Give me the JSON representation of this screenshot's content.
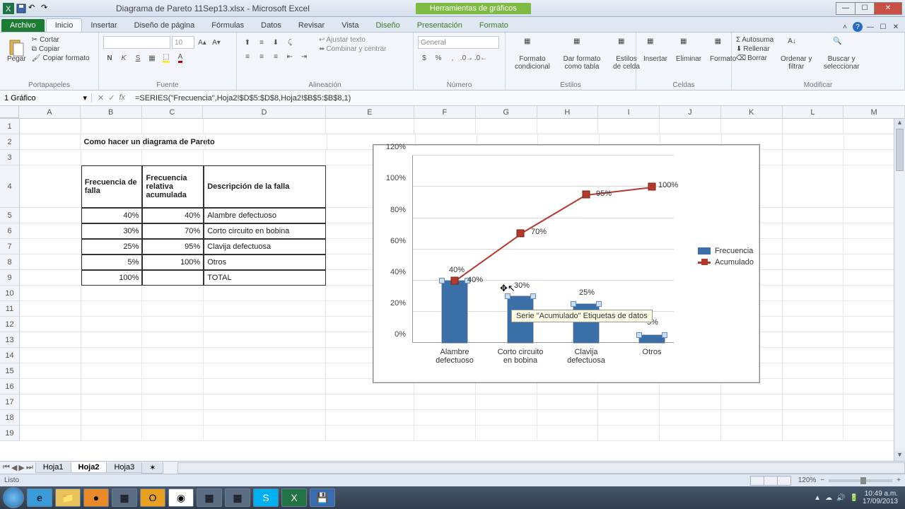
{
  "window": {
    "title": "Diagrama de Pareto 11Sep13.xlsx - Microsoft Excel",
    "chart_tools": "Herramientas de gráficos"
  },
  "ribbon": {
    "file": "Archivo",
    "tabs": [
      "Inicio",
      "Insertar",
      "Diseño de página",
      "Fórmulas",
      "Datos",
      "Revisar",
      "Vista",
      "Diseño",
      "Presentación",
      "Formato"
    ],
    "active_tab": "Inicio",
    "clipboard": {
      "paste": "Pegar",
      "cut": "Cortar",
      "copy": "Copiar",
      "format_painter": "Copiar formato",
      "label": "Portapapeles"
    },
    "font": {
      "label": "Fuente",
      "size": "10",
      "bold": "N",
      "italic": "K",
      "underline": "S"
    },
    "alignment": {
      "label": "Alineación",
      "wrap": "Ajustar texto",
      "merge": "Combinar y centrar"
    },
    "number": {
      "label": "Número",
      "format": "General"
    },
    "styles": {
      "label": "Estilos",
      "cond": "Formato condicional",
      "astable": "Dar formato como tabla",
      "cellstyles": "Estilos de celda"
    },
    "cells": {
      "label": "Celdas",
      "insert": "Insertar",
      "delete": "Eliminar",
      "format": "Formato"
    },
    "editing": {
      "label": "Modificar",
      "autosum": "Autosuma",
      "fill": "Rellenar",
      "clear": "Borrar",
      "sort": "Ordenar y filtrar",
      "find": "Buscar y seleccionar"
    }
  },
  "formula_bar": {
    "name": "1 Gráfico",
    "fx": "=SERIES(\"Frecuencia\",Hoja2!$D$5:$D$8,Hoja2!$B$5:$B$8,1)"
  },
  "columns": [
    "A",
    "B",
    "C",
    "D",
    "E",
    "F",
    "G",
    "H",
    "I",
    "J",
    "K",
    "L",
    "M"
  ],
  "sheet": {
    "title_cell": "Como hacer un diagrama de Pareto",
    "headers": [
      "Frecuencia de falla",
      "Frecuencia relativa acumulada",
      "Descripción de la falla"
    ],
    "rows": [
      {
        "freq": "40%",
        "acc": "40%",
        "desc": "Alambre defectuoso"
      },
      {
        "freq": "30%",
        "acc": "70%",
        "desc": "Corto circuito en bobina"
      },
      {
        "freq": "25%",
        "acc": "95%",
        "desc": "Clavija defectuosa"
      },
      {
        "freq": "5%",
        "acc": "100%",
        "desc": "Otros"
      }
    ],
    "total": {
      "freq": "100%",
      "desc": "TOTAL"
    }
  },
  "chart_data": {
    "type": "bar",
    "categories": [
      "Alambre defectuoso",
      "Corto circuito en bobina",
      "Clavija defectuosa",
      "Otros"
    ],
    "series": [
      {
        "name": "Frecuencia",
        "type": "bar",
        "values": [
          40,
          30,
          25,
          5
        ]
      },
      {
        "name": "Acumulado",
        "type": "line",
        "values": [
          40,
          70,
          95,
          100
        ]
      }
    ],
    "yticks": [
      "0%",
      "20%",
      "40%",
      "60%",
      "80%",
      "100%",
      "120%"
    ],
    "ylim": [
      0,
      120
    ],
    "legend": [
      "Frecuencia",
      "Acumulado"
    ],
    "tooltip": "Serie \"Acumulado\" Etiquetas de datos",
    "data_labels_bar": [
      "40%",
      "30%",
      "25%",
      "5%"
    ],
    "data_labels_line": [
      "40%",
      "70%",
      "95%",
      "100%"
    ]
  },
  "sheets": {
    "tabs": [
      "Hoja1",
      "Hoja2",
      "Hoja3"
    ],
    "active": "Hoja2"
  },
  "status": {
    "ready": "Listo",
    "zoom": "120%"
  },
  "tray": {
    "time": "10:49 a.m.",
    "date": "17/09/2013"
  }
}
